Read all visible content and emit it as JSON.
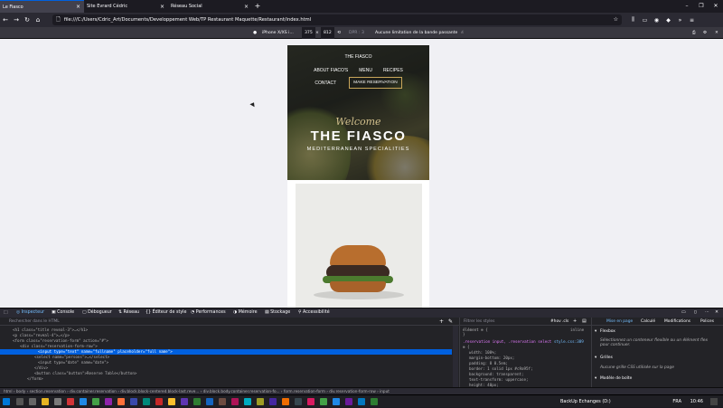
{
  "tabs": [
    {
      "title": "Le Fiasco",
      "active": true
    },
    {
      "title": "Site Evrard Cédric",
      "active": false
    },
    {
      "title": "Réseau Social",
      "active": false
    }
  ],
  "url": "file:///C:/Users/Cdric_Art/Documents/Developpement Web/TP Restaurant Maquette/Restaurant/index.html",
  "rdm": {
    "device": "iPhone X/XS i...",
    "width": "375",
    "height": "812",
    "dpr": "DPR : 3",
    "throttle": "Aucune limitation de la bande passante"
  },
  "site": {
    "logo": "THE FIASCO",
    "menu": [
      "ABOUT FIACO'S",
      "MENU",
      "RECIPES"
    ],
    "contact": "CONTACT",
    "reserve_btn": "MAKE RESERVATION",
    "welcome": "Welcome",
    "title": "THE FIASCO",
    "subtitle": "MEDITERRANEAN SPECIALITIES"
  },
  "devtools": {
    "tabs": [
      "Inspecteur",
      "Console",
      "Débogueur",
      "Réseau",
      "Éditeur de style",
      "Performances",
      "Mémoire",
      "Stockage",
      "Accessibilité"
    ],
    "search_placeholder": "Rechercher dans le HTML",
    "filter_placeholder": "Filtrer les styles",
    "filter_btns": [
      "#hov",
      ".cls"
    ],
    "layout_tabs": [
      "Mise en page",
      "Calculé",
      "Modifications",
      "Polices"
    ],
    "flexbox_title": "Flexbox",
    "flexbox_msg": "Sélectionnez un conteneur flexible ou un élément flex pour continuer.",
    "grilles_title": "Grilles",
    "grilles_msg": "Aucune grille CSS utilisée sur la page",
    "box_title": "Modèle de boîte",
    "rule_source": "style.css:389",
    "element_label": "élément",
    "inline_label": "inline",
    "rule_selector": ".reservation input, .reservation select",
    "rule_props": [
      "width: 100%;",
      "margin-bottom: 20px;",
      "padding: 8 0.5em;",
      "border: 1 solid 1px #c9a95f;",
      "background: transparent;",
      "text-transform: uppercase;",
      "height: 40px;",
      "color: #fff;"
    ],
    "code": [
      "<h1 class=\"title reveal-3\">…</h1>",
      "<p class=\"reveal-4\">…</p>",
      "<form class=\"reservation-form\" action=\"#\">",
      "<div class=\"reservation-form-row\">",
      "<input type=\"text\" name=\"fullname\" placeholder=\"full name\">",
      "<select name=\"persons\">…</select>",
      "<input type=\"date\" name=\"date\">",
      "</div>",
      "<button class=\"button\">Reserve Table</button>",
      "</form>"
    ],
    "breadcrumb": "html › body › section.reservation › div.container.reservation › div.block.block-centered.block-last.reve... › div.block.body.container.reservation-fo... › form.reservation-form › div.reservation-form-row › input"
  },
  "taskbar": {
    "backup": "BackUp Echanges (D:)",
    "lang": "FRA",
    "time": "10:46"
  }
}
